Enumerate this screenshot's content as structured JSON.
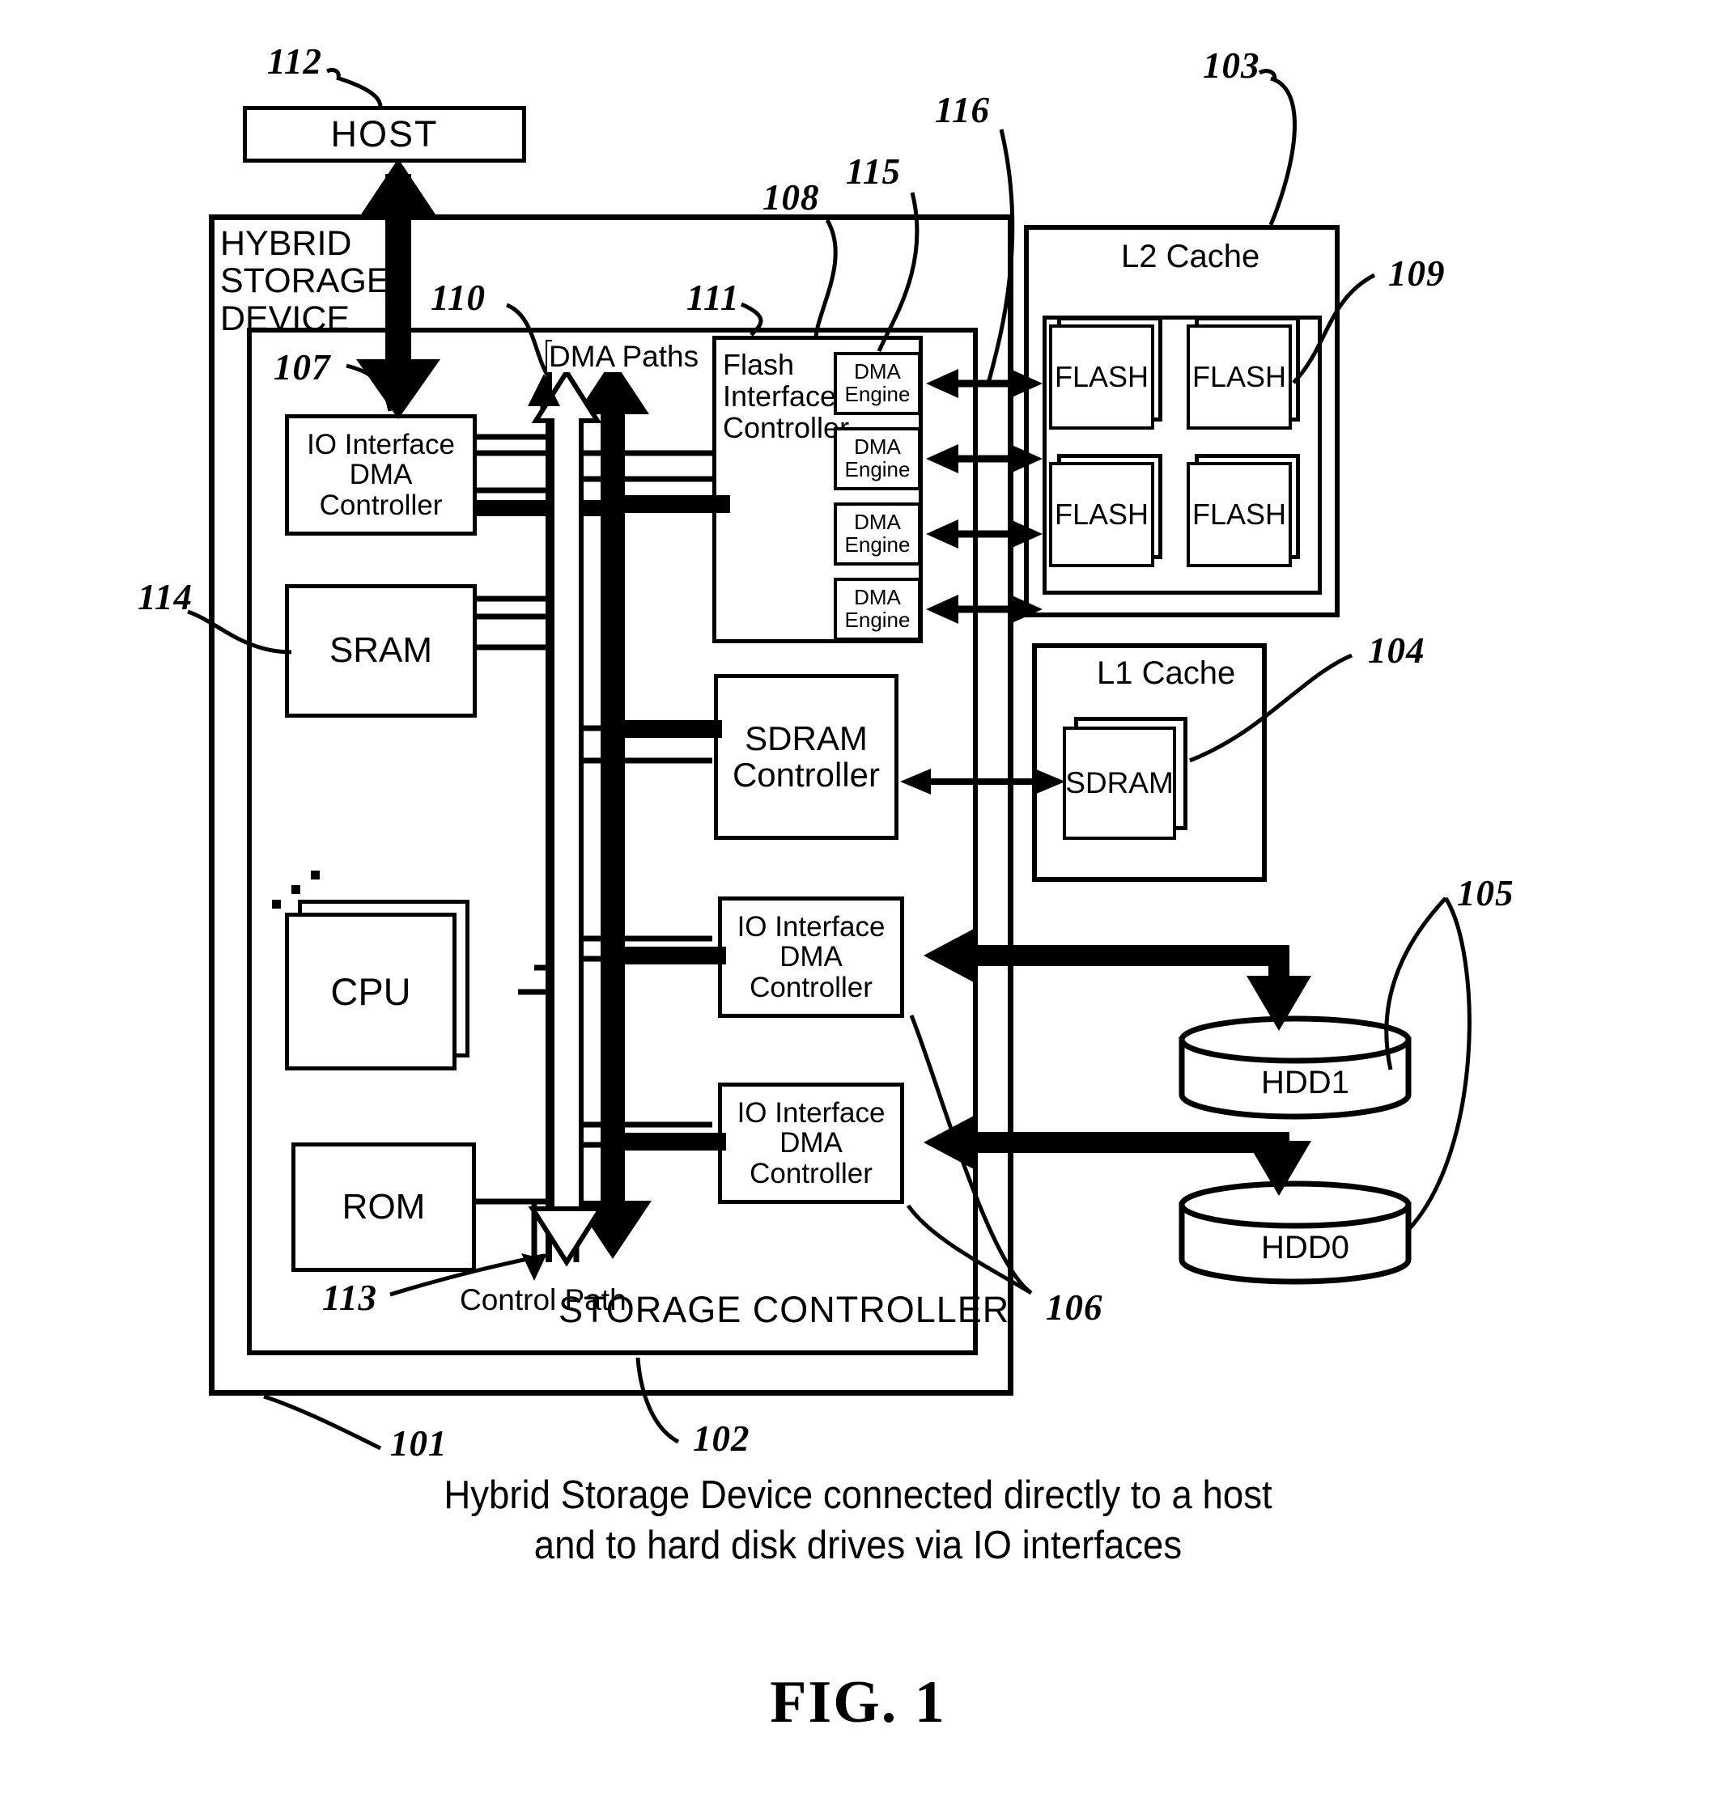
{
  "figure": {
    "label": "FIG. 1",
    "caption_line1": "Hybrid Storage Device connected directly to a host",
    "caption_line2": "and to hard disk drives via IO interfaces"
  },
  "host": {
    "label": "HOST"
  },
  "hybrid_device": {
    "label_line1": "HYBRID",
    "label_line2": "STORAGE",
    "label_line3": "DEVICE"
  },
  "storage_controller": {
    "label": "STORAGE CONTROLLER"
  },
  "paths": {
    "dma": "DMA Paths",
    "control": "Control Path"
  },
  "left_column": {
    "io_dma_controller": {
      "line1": "IO Interface",
      "line2": "DMA",
      "line3": "Controller"
    },
    "sram": {
      "label": "SRAM"
    },
    "cpu": {
      "label": "CPU"
    },
    "rom": {
      "label": "ROM"
    }
  },
  "middle_column": {
    "flash_interface_controller": {
      "line1": "Flash",
      "line2": "Interface",
      "line3": "Controller"
    },
    "dma_engines": [
      {
        "line1": "DMA",
        "line2": "Engine"
      },
      {
        "line1": "DMA",
        "line2": "Engine"
      },
      {
        "line1": "DMA",
        "line2": "Engine"
      },
      {
        "line1": "DMA",
        "line2": "Engine"
      }
    ],
    "sdram_controller": {
      "line1": "SDRAM",
      "line2": "Controller"
    },
    "io_dma_controller_hdd1": {
      "line1": "IO Interface",
      "line2": "DMA",
      "line3": "Controller"
    },
    "io_dma_controller_hdd0": {
      "line1": "IO Interface",
      "line2": "DMA",
      "line3": "Controller"
    }
  },
  "right_column": {
    "l2_cache": {
      "title": "L2 Cache",
      "flash": [
        {
          "label": "FLASH"
        },
        {
          "label": "FLASH"
        },
        {
          "label": "FLASH"
        },
        {
          "label": "FLASH"
        }
      ]
    },
    "l1_cache": {
      "title": "L1 Cache",
      "sdram": {
        "label": "SDRAM"
      }
    },
    "drives": [
      {
        "label": "HDD1"
      },
      {
        "label": "HDD0"
      }
    ]
  },
  "reference_numerals": {
    "n101": "101",
    "n102": "102",
    "n103": "103",
    "n104": "104",
    "n105": "105",
    "n106": "106",
    "n107": "107",
    "n108": "108",
    "n109": "109",
    "n110": "110",
    "n111": "111",
    "n112": "112",
    "n113": "113",
    "n114": "114",
    "n115": "115",
    "n116": "116"
  },
  "colors": {
    "ink": "#000000",
    "paper": "#ffffff"
  }
}
